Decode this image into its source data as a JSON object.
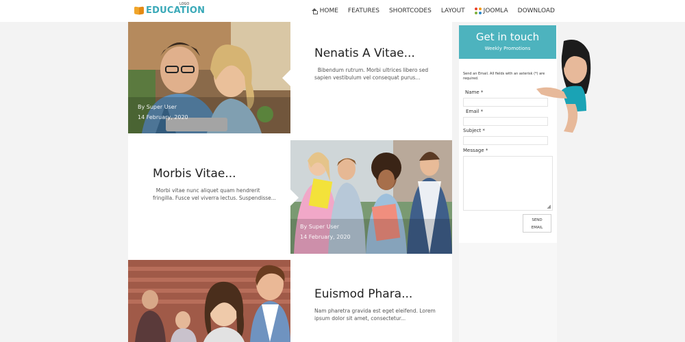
{
  "header": {
    "logo_text": "EDUCATION",
    "logo_small": "LOGO",
    "nav": [
      {
        "label": "HOME",
        "icon": "home-icon"
      },
      {
        "label": "FEATURES"
      },
      {
        "label": "SHORTCODES"
      },
      {
        "label": "LAYOUT"
      },
      {
        "label": "JOOMLA",
        "icon": "joomla-icon"
      },
      {
        "label": "DOWNLOAD"
      }
    ]
  },
  "posts": [
    {
      "title": "Nenatis A Vitae...",
      "excerpt": "Bibendum rutrum. Morbi ultrices libero sed sapien vestibulum vel consequat purus...",
      "author": "By Super User",
      "date": "14 February, 2020"
    },
    {
      "title": "Morbis Vitae...",
      "excerpt": "Morbi vitae nunc aliquet quam hendrerit fringilla. Fusce vel viverra lectus. Suspendisse...",
      "author": "By Super User",
      "date": "14 February, 2020"
    },
    {
      "title": "Euismod Phara...",
      "excerpt": "Nam pharetra gravida est eget eleifend. Lorem ipsum dolor sit amet, consectetur..."
    }
  ],
  "sidebar": {
    "title": "Get in touch",
    "subtitle": "Weekly Promotions",
    "note": "Send an Email. All fields with an asterisk (*) are required.",
    "fields": {
      "name": "Name *",
      "email": "Email *",
      "subject": "Subject *",
      "message": "Message *"
    },
    "send_line1": "SEND",
    "send_line2": "EMAIL"
  },
  "colors": {
    "accent": "#4db3be",
    "logo": "#3aa9b8",
    "logo_book": "#f0a52a"
  }
}
